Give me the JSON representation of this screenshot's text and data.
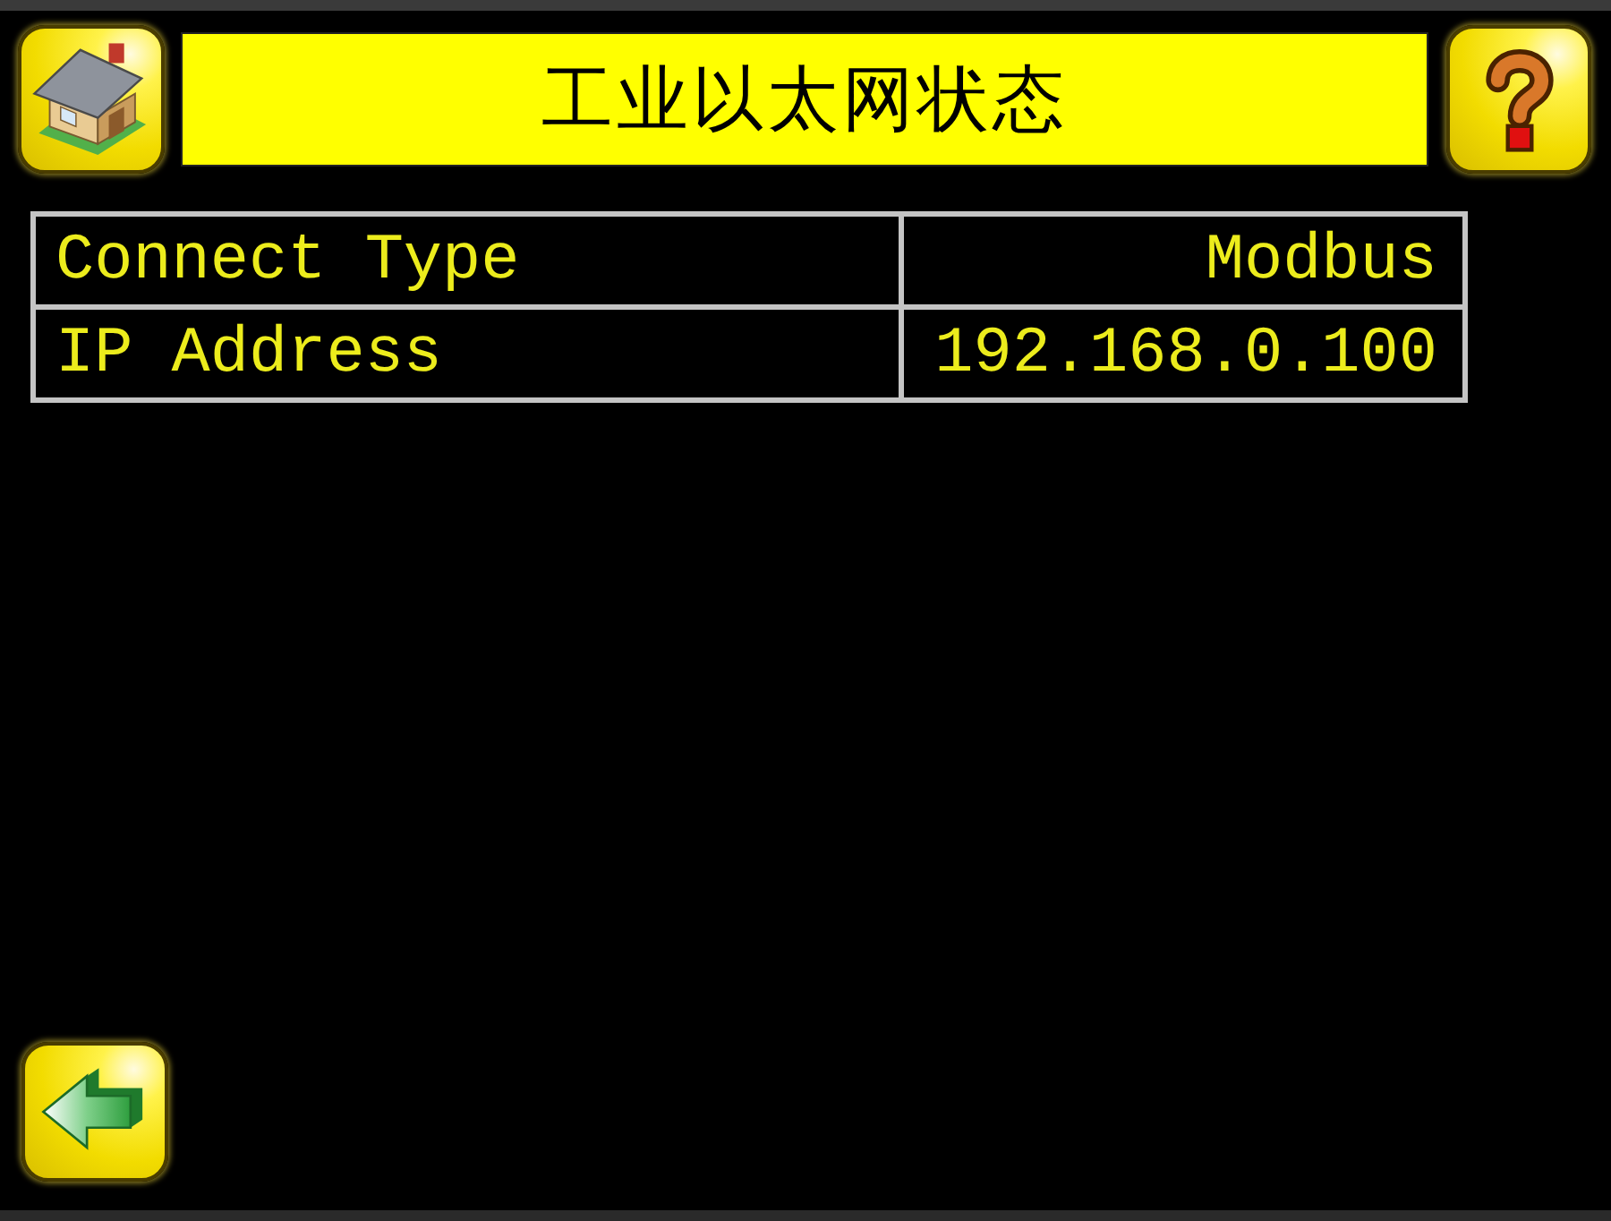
{
  "header": {
    "title": "工业以太网状态"
  },
  "table": {
    "rows": [
      {
        "label": "Connect Type",
        "value": "Modbus"
      },
      {
        "label": "IP Address",
        "value": "192.168.0.100"
      }
    ]
  }
}
